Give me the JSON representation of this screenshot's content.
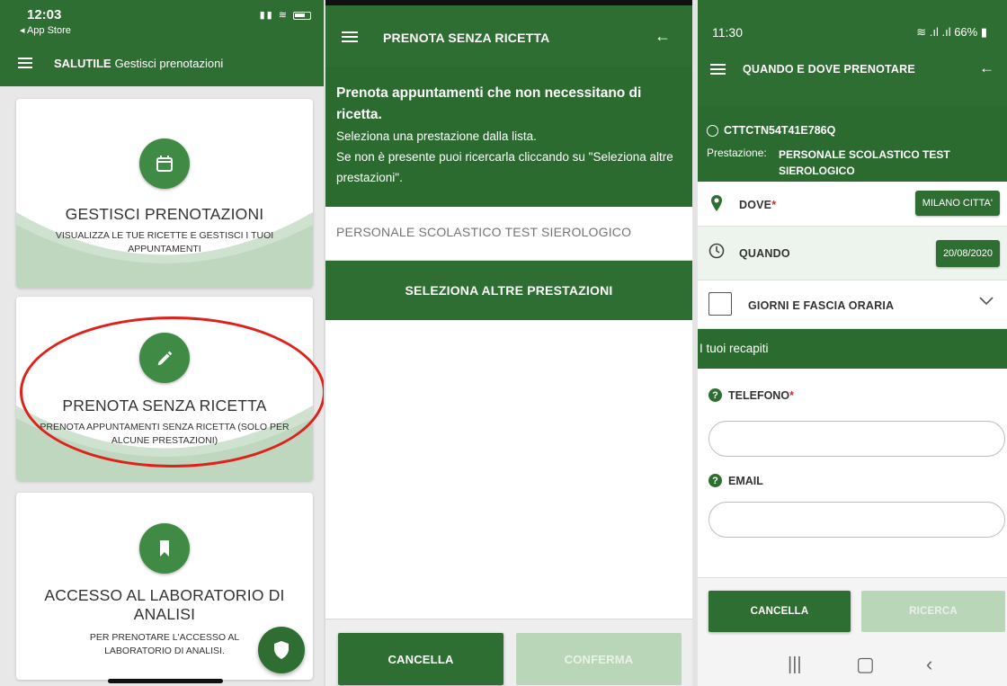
{
  "screen1": {
    "status": {
      "time": "12:03",
      "back_label": "◂ App Store"
    },
    "header": {
      "brand": "SALUTILE",
      "title": "Gestisci prenotazioni"
    },
    "cards": [
      {
        "title": "GESTISCI PRENOTAZIONI",
        "subtitle": "VISUALIZZA LE TUE RICETTE E GESTISCI I TUOI APPUNTAMENTI",
        "icon": "calendar-icon"
      },
      {
        "title": "PRENOTA SENZA RICETTA",
        "subtitle": "PRENOTA APPUNTAMENTI SENZA RICETTA (SOLO PER ALCUNE PRESTAZIONI)",
        "icon": "pencil-icon"
      },
      {
        "title": "ACCESSO AL LABORATORIO DI ANALISI",
        "subtitle": "PER PRENOTARE L'ACCESSO AL LABORATORIO DI ANALISI.",
        "icon": "bookmark-icon"
      }
    ],
    "fab_icon": "shield-icon"
  },
  "screen2": {
    "header": {
      "title": "PRENOTA SENZA RICETTA"
    },
    "info": {
      "lead": "Prenota appuntamenti che non necessitano di ricetta.",
      "line1": "Seleziona una prestazione dalla lista.",
      "line2": "Se non è presente puoi ricercarla cliccando su \"Seleziona altre prestazioni\"."
    },
    "service_item": "PERSONALE SCOLASTICO TEST SIEROLOGICO",
    "select_other_label": "SELEZIONA ALTRE PRESTAZIONI",
    "cancel_label": "CANCELLA",
    "confirm_label": "CONFERMA"
  },
  "screen3": {
    "status": {
      "time": "11:30",
      "battery": "66%"
    },
    "header": {
      "title": "QUANDO E DOVE PRENOTARE"
    },
    "patient_code": "CTTCTN54T41E786Q",
    "service_label": "Prestazione:",
    "service_value": "PERSONALE SCOLASTICO TEST SIEROLOGICO",
    "where_label": "DOVE",
    "where_value": "MILANO CITTA'",
    "when_label": "QUANDO",
    "when_value": "20/08/2020",
    "days_label": "GIORNI E FASCIA ORARIA",
    "contacts_title": "I tuoi recapiti",
    "phone_label": "TELEFONO",
    "email_label": "EMAIL",
    "phone_value": "",
    "email_value": "",
    "required_mark": "*",
    "cancel_label": "CANCELLA",
    "search_label": "RICERCA"
  },
  "colors": {
    "primary_green": "#2f6e32",
    "disabled_green": "#b9d6b9",
    "annotation_red": "#e0201a"
  }
}
